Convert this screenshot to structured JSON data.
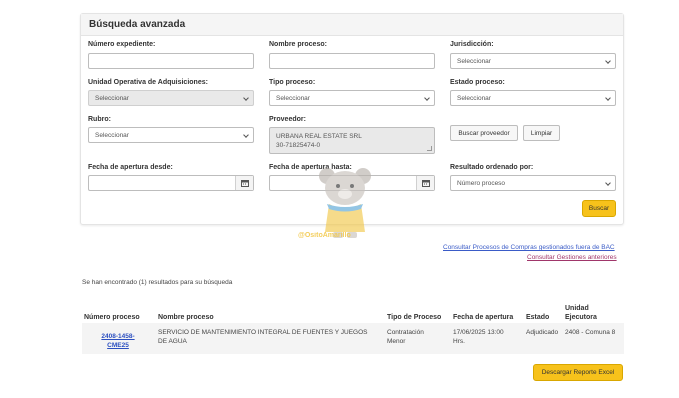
{
  "panel": {
    "title": "Búsqueda avanzada"
  },
  "fields": {
    "numero_expediente": {
      "label": "Número expediente:",
      "value": ""
    },
    "nombre_proceso": {
      "label": "Nombre proceso:",
      "value": ""
    },
    "jurisdiccion": {
      "label": "Jurisdicción:",
      "value": "Seleccionar"
    },
    "unidad_operativa": {
      "label": "Unidad Operativa de Adquisiciones:",
      "value": "Seleccionar"
    },
    "tipo_proceso": {
      "label": "Tipo proceso:",
      "value": "Seleccionar"
    },
    "estado_proceso": {
      "label": "Estado proceso:",
      "value": "Seleccionar"
    },
    "rubro": {
      "label": "Rubro:",
      "value": "Seleccionar"
    },
    "proveedor": {
      "label": "Proveedor:",
      "line1": "URBANA REAL ESTATE SRL",
      "line2": "30-71825474-0"
    },
    "fecha_desde": {
      "label": "Fecha de apertura desde:",
      "value": ""
    },
    "fecha_hasta": {
      "label": "Fecha de apertura hasta:",
      "value": ""
    },
    "resultado_ordenado": {
      "label": "Resultado ordenado por:",
      "value": "Número proceso"
    }
  },
  "buttons": {
    "buscar_proveedor": "Buscar proveedor",
    "limpiar": "Limpiar",
    "buscar": "Buscar",
    "descargar": "Descargar Reporte Excel"
  },
  "links": {
    "consultar_fuera_bac": "Consultar Procesos de Compras gestionados fuera de BAC",
    "consultar_anteriores": "Consultar Gestiones anteriores"
  },
  "results": {
    "message": "Se han encontrado (1) resultados para su búsqueda",
    "headers": [
      "Número proceso",
      "Nombre proceso",
      "Tipo de Proceso",
      "Fecha de apertura",
      "Estado",
      "Unidad Ejecutora"
    ],
    "rows": [
      {
        "numero": "2408-1458-CME25",
        "nombre": "SERVICIO DE MANTENIMIENTO INTEGRAL DE FUENTES Y JUEGOS DE AGUA",
        "tipo": "Contratación Menor",
        "fecha": "17/06/2025 13:00 Hrs.",
        "estado": "Adjudicado",
        "unidad": "2408 - Comuna 8"
      }
    ]
  },
  "watermark": "@OsitoAmarillo",
  "colors": {
    "accent": "#f7c21b",
    "link": "#3a5bc7"
  }
}
